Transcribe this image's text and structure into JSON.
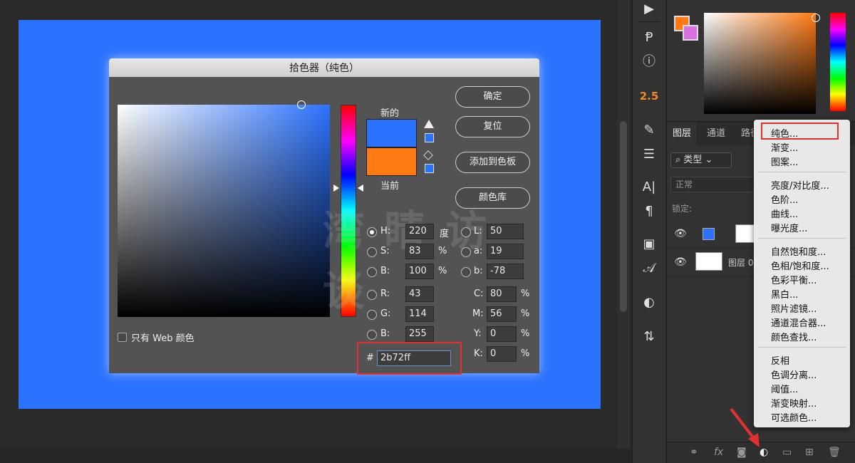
{
  "dialog": {
    "title": "拾色器（纯色）",
    "new_label": "新的",
    "current_label": "当前",
    "web_only_label": "只有 Web 颜色",
    "buttons": {
      "ok": "确定",
      "reset": "复位",
      "add_swatch": "添加到色板",
      "libraries": "颜色库"
    },
    "fields": {
      "H": {
        "label": "H:",
        "value": "220",
        "unit": "度"
      },
      "S": {
        "label": "S:",
        "value": "83",
        "unit": "%"
      },
      "Bv": {
        "label": "B:",
        "value": "100",
        "unit": "%"
      },
      "R": {
        "label": "R:",
        "value": "43"
      },
      "G": {
        "label": "G:",
        "value": "114"
      },
      "Bl": {
        "label": "B:",
        "value": "255"
      },
      "L": {
        "label": "L:",
        "value": "50"
      },
      "a": {
        "label": "a:",
        "value": "19"
      },
      "b": {
        "label": "b:",
        "value": "-78"
      },
      "C": {
        "label": "C:",
        "value": "80",
        "unit": "%"
      },
      "M": {
        "label": "M:",
        "value": "56",
        "unit": "%"
      },
      "Y": {
        "label": "Y:",
        "value": "0",
        "unit": "%"
      },
      "K": {
        "label": "K:",
        "value": "0",
        "unit": "%"
      }
    },
    "hex_symbol": "#",
    "hex": "2b72ff",
    "new_color": "#2b72ff",
    "current_color": "#ff7a12"
  },
  "watermark": "湾 睛 访 谈",
  "tools": {
    "badge": "2.5"
  },
  "layers_panel": {
    "tabs": [
      "图层",
      "通道",
      "路径"
    ],
    "filter_label": "类型",
    "blend_mode": "正常",
    "lock_label": "锁定:",
    "layers": [
      {
        "name": ""
      },
      {
        "name": "图层 0"
      }
    ]
  },
  "menu": {
    "items": [
      "纯色...",
      "渐变...",
      "图案...",
      "亮度/对比度...",
      "色阶...",
      "曲线...",
      "曝光度...",
      "自然饱和度...",
      "色相/饱和度...",
      "色彩平衡...",
      "黑白...",
      "照片滤镜...",
      "通道混合器...",
      "颜色查找...",
      "反相",
      "色调分离...",
      "阈值...",
      "渐变映射...",
      "可选颜色..."
    ]
  },
  "colors": {
    "canvas": "#2b72ff",
    "foreground": "#ff7a12",
    "background": "#d96fe0",
    "highlight": "#e53030"
  }
}
